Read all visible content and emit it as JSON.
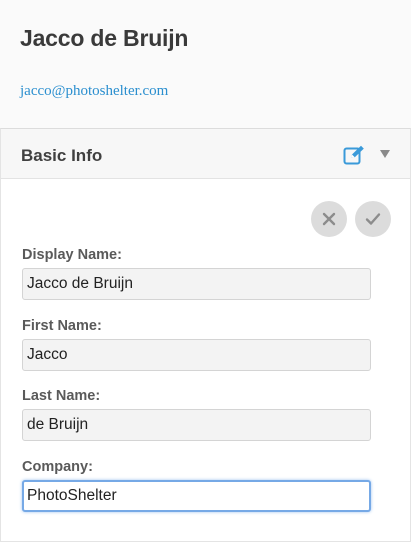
{
  "profile": {
    "name": "Jacco de Bruijn",
    "email": "jacco@photoshelter.com"
  },
  "panel": {
    "title": "Basic Info",
    "edit_icon": "edit-square-icon",
    "collapse_icon": "triangle-down-icon",
    "cancel_icon": "x-icon",
    "confirm_icon": "check-icon"
  },
  "fields": {
    "display_name": {
      "label": "Display Name:",
      "value": "Jacco de Bruijn"
    },
    "first_name": {
      "label": "First Name:",
      "value": "Jacco"
    },
    "last_name": {
      "label": "Last Name:",
      "value": "de Bruijn"
    },
    "company": {
      "label": "Company:",
      "value": "PhotoShelter"
    }
  },
  "colors": {
    "link": "#2b8fcf",
    "edit_icon": "#3a9ad9",
    "focus_ring": "#76a9e6"
  }
}
